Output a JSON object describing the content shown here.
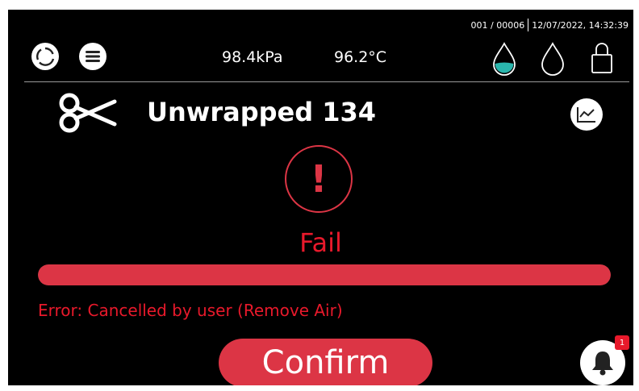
{
  "header": {
    "cycle_counter": "001 / 00006",
    "datetime": "12/07/2022, 14:32:39",
    "pressure": "98.4kPa",
    "temperature": "96.2°C"
  },
  "icons": {
    "refresh": "refresh-icon",
    "menu": "menu-icon",
    "water_full": "water-drop-filled-icon",
    "water_empty": "water-drop-empty-icon",
    "lock": "lock-icon",
    "scissors": "scissors-icon",
    "graph": "line-graph-icon",
    "bell": "bell-icon"
  },
  "program": {
    "title": "Unwrapped 134"
  },
  "status": {
    "alert_symbol": "!",
    "label": "Fail",
    "progress": 1.0,
    "error_message": "Error: Cancelled by user (Remove Air)"
  },
  "actions": {
    "confirm_label": "Confirm"
  },
  "notifications": {
    "badge_count": "1"
  },
  "colors": {
    "background": "#000000",
    "error_red": "#dc3545",
    "text_red": "#e8192b",
    "water_teal": "#2ab6ad",
    "foreground": "#ffffff"
  }
}
